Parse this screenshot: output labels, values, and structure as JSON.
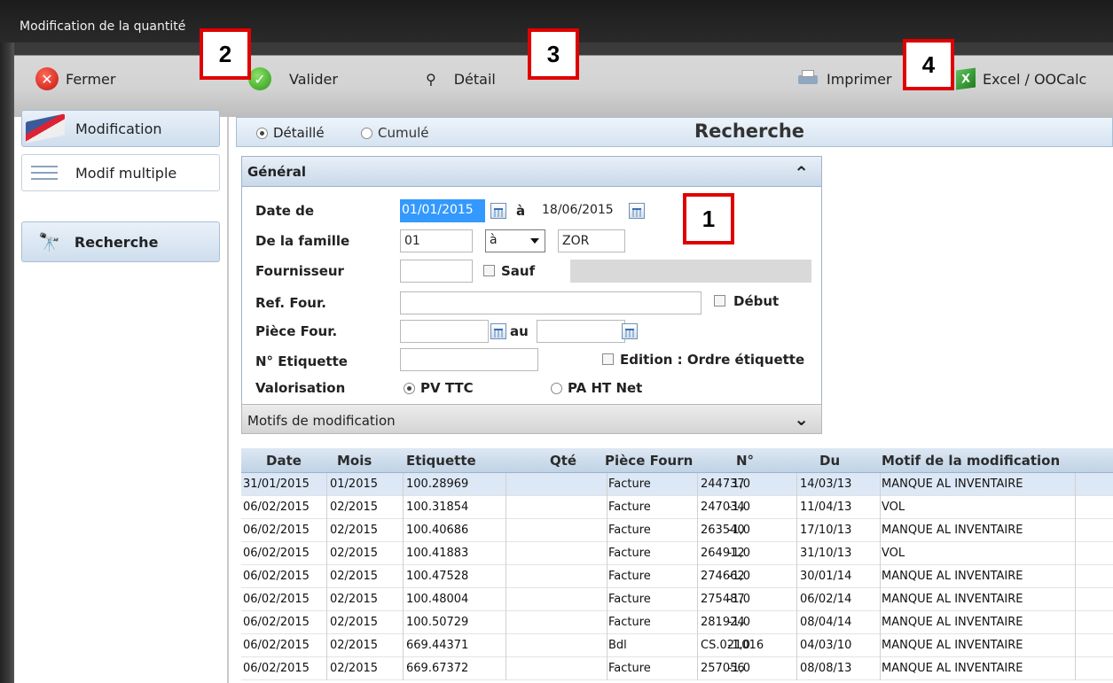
{
  "window": {
    "title": "Modification de la quantité"
  },
  "toolbar": {
    "close_label": "Fermer",
    "validate_label": "Valider",
    "detail_label": "Détail",
    "print_label": "Imprimer",
    "excel_label": "Excel / OOCalc"
  },
  "callouts": [
    "1",
    "2",
    "3",
    "4"
  ],
  "sidebar": {
    "items": [
      {
        "label": "Modification",
        "icon": "flag-icon"
      },
      {
        "label": "Modif multiple",
        "icon": "list-icon"
      },
      {
        "label": "Recherche",
        "icon": "binoculars-icon"
      }
    ]
  },
  "search": {
    "mode_detail": "Détaillé",
    "mode_cumul": "Cumulé",
    "mode_selected": "Détaillé",
    "heading": "Recherche"
  },
  "general": {
    "title": "Général",
    "date_label": "Date de",
    "date_from": "01/01/2015",
    "date_to_label": "à",
    "date_to": "18/06/2015",
    "famille_label": "De la famille",
    "famille_from": "01",
    "famille_op": "à",
    "famille_to": "ZOR",
    "fournisseur_label": "Fournisseur",
    "fournisseur_value": "",
    "sauf_label": "Sauf",
    "ref_four_label": "Ref. Four.",
    "ref_four_value": "",
    "debut_label": "Début",
    "piece_four_label": "Pièce Four.",
    "piece_au_label": "au",
    "etiquette_label": "N° Etiquette",
    "etiquette_value": "",
    "edition_label": "Edition : Ordre étiquette",
    "valorisation_label": "Valorisation",
    "val_pv": "PV TTC",
    "val_pa": "PA HT Net",
    "val_selected": "PV TTC"
  },
  "motifs": {
    "title": "Motifs de modification"
  },
  "table": {
    "columns": [
      "Date",
      "Mois",
      "Etiquette",
      "Qté",
      "Pièce Fourn",
      "N°",
      "Du",
      "Motif de la modification"
    ],
    "rows": [
      [
        "31/01/2015",
        "01/2015",
        "100.28969",
        "1,0",
        "Facture",
        "244737",
        "14/03/13",
        "MANQUE AL INVENTAIRE"
      ],
      [
        "06/02/2015",
        "02/2015",
        "100.31854",
        "-1,0",
        "Facture",
        "247034",
        "11/04/13",
        "VOL"
      ],
      [
        "06/02/2015",
        "02/2015",
        "100.40686",
        "-1,0",
        "Facture",
        "263540",
        "17/10/13",
        "MANQUE AL INVENTAIRE"
      ],
      [
        "06/02/2015",
        "02/2015",
        "100.41883",
        "-1,0",
        "Facture",
        "264912",
        "31/10/13",
        "VOL"
      ],
      [
        "06/02/2015",
        "02/2015",
        "100.47528",
        "-1,0",
        "Facture",
        "274662",
        "30/01/14",
        "MANQUE AL INVENTAIRE"
      ],
      [
        "06/02/2015",
        "02/2015",
        "100.48004",
        "-1,0",
        "Facture",
        "275487",
        "06/02/14",
        "MANQUE AL INVENTAIRE"
      ],
      [
        "06/02/2015",
        "02/2015",
        "100.50729",
        "-1,0",
        "Facture",
        "281924",
        "08/04/14",
        "MANQUE AL INVENTAIRE"
      ],
      [
        "06/02/2015",
        "02/2015",
        "669.44371",
        "-1,0",
        "Bdl",
        "CS.021016",
        "04/03/10",
        "MANQUE AL INVENTAIRE"
      ],
      [
        "06/02/2015",
        "02/2015",
        "669.67372",
        "-1,0",
        "Facture",
        "257056",
        "08/08/13",
        "MANQUE AL INVENTAIRE"
      ]
    ]
  }
}
